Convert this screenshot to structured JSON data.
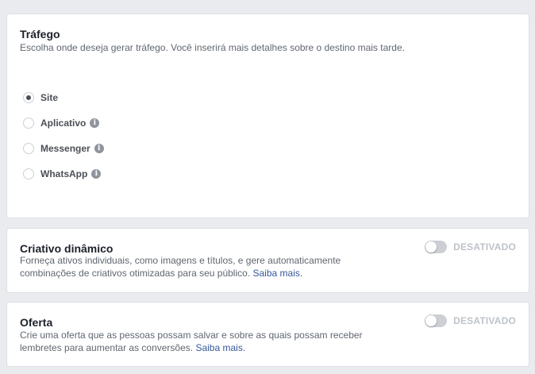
{
  "traffic": {
    "title": "Tráfego",
    "description": "Escolha onde deseja gerar tráfego. Você inserirá mais detalhes sobre o destino mais tarde.",
    "options": [
      {
        "label": "Site",
        "selected": true,
        "info_icon": false
      },
      {
        "label": "Aplicativo",
        "selected": false,
        "info_icon": true
      },
      {
        "label": "Messenger",
        "selected": false,
        "info_icon": true
      },
      {
        "label": "WhatsApp",
        "selected": false,
        "info_icon": true
      }
    ]
  },
  "dynamic_creative": {
    "title": "Criativo dinâmico",
    "description": "Forneça ativos individuais, como imagens e títulos, e gere automaticamente combinações de criativos otimizadas para seu público.",
    "link": "Saiba mais.",
    "toggle_label": "DESATIVADO",
    "enabled": false
  },
  "offer": {
    "title": "Oferta",
    "description": "Crie uma oferta que as pessoas possam salvar e sobre as quais possam receber lembretes para aumentar as conversões.",
    "link": "Saiba mais.",
    "toggle_label": "DESATIVADO",
    "enabled": false
  },
  "colors": {
    "background": "#e9ebee",
    "link": "#365899",
    "toggle_off": "#ccd0d5"
  }
}
